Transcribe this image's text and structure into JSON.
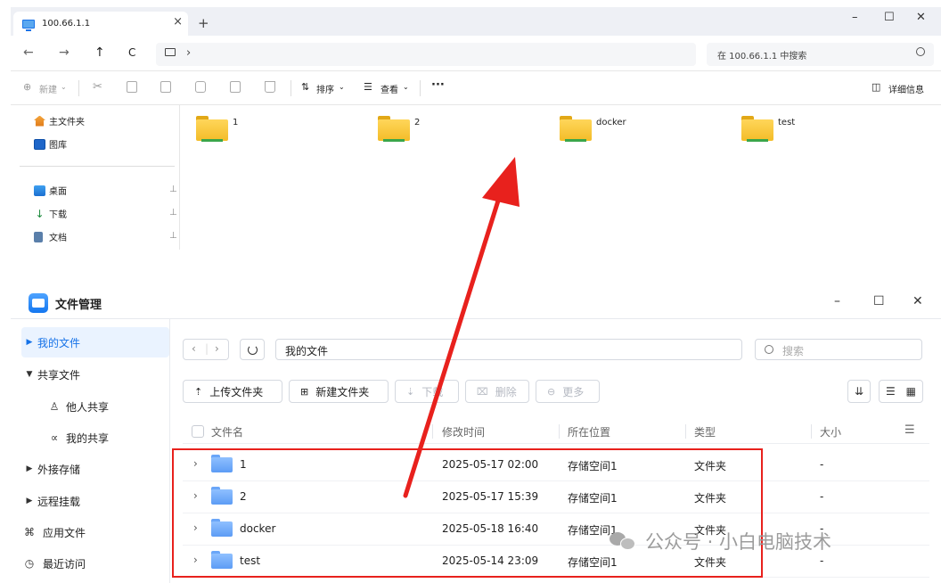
{
  "explorer": {
    "tab_title": "100.66.1.1",
    "tab_close": "×",
    "new_tab": "+",
    "window_controls": {
      "minimize": "–",
      "maximize": "☐",
      "close": "✕"
    },
    "nav": {
      "back": "←",
      "forward": "→",
      "up": "↑",
      "refresh": "C",
      "crumb_chevron": "›"
    },
    "search_placeholder": "在 100.66.1.1 中搜索",
    "toolbar": {
      "new_label": "新建",
      "sort_label": "排序",
      "view_label": "查看",
      "more": "···",
      "details_label": "详细信息"
    },
    "sidebar": {
      "quick": [
        {
          "label": "主文件夹",
          "icon": "home-icon"
        },
        {
          "label": "图库",
          "icon": "gallery-icon"
        }
      ],
      "pinned": [
        {
          "label": "桌面",
          "icon": "desktop-icon"
        },
        {
          "label": "下载",
          "icon": "download-icon"
        },
        {
          "label": "文档",
          "icon": "document-icon"
        }
      ],
      "pin_glyph": "📌"
    },
    "folders": [
      "1",
      "2",
      "docker",
      "test"
    ]
  },
  "nas": {
    "app_title": "文件管理",
    "window_controls": {
      "minimize": "–",
      "maximize": "☐",
      "close": "✕"
    },
    "sidebar": {
      "my_files": "我的文件",
      "shared_files": "共享文件",
      "others_shared": "他人共享",
      "my_shared": "我的共享",
      "external_storage": "外接存储",
      "remote_mount": "远程挂载",
      "app_files": "应用文件",
      "recent": "最近访问"
    },
    "path": "我的文件",
    "search_placeholder": "搜索",
    "actions": {
      "upload_folder": "上传文件夹",
      "new_folder": "新建文件夹",
      "download": "下载",
      "delete": "删除",
      "more": "更多"
    },
    "columns": {
      "name": "文件名",
      "modified": "修改时间",
      "location": "所在位置",
      "type": "类型",
      "size": "大小"
    },
    "rows": [
      {
        "name": "1",
        "modified": "2025-05-17 02:00",
        "location": "存储空间1",
        "type": "文件夹",
        "size": "-"
      },
      {
        "name": "2",
        "modified": "2025-05-17 15:39",
        "location": "存储空间1",
        "type": "文件夹",
        "size": "-"
      },
      {
        "name": "docker",
        "modified": "2025-05-18 16:40",
        "location": "存储空间1",
        "type": "文件夹",
        "size": "-"
      },
      {
        "name": "test",
        "modified": "2025-05-14 23:09",
        "location": "存储空间1",
        "type": "文件夹",
        "size": "-"
      }
    ]
  },
  "watermark": "公众号 · 小白电脑技术",
  "colors": {
    "highlight_red": "#e8211d",
    "accent_blue": "#1572e8",
    "folder_yellow": "#f3bc28"
  }
}
